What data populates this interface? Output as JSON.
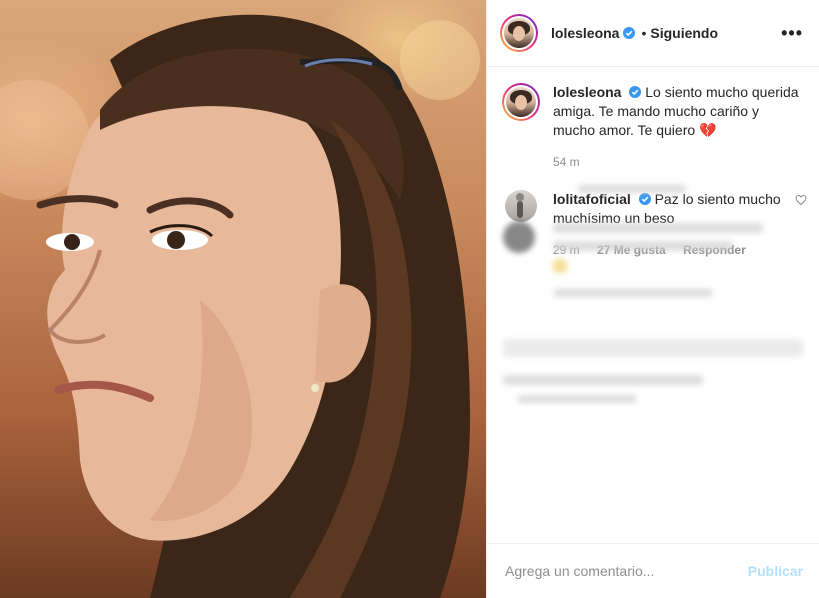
{
  "post": {
    "author": "lolesleona",
    "separator": "•",
    "follow_status": "Siguiendo",
    "more_label": "•••"
  },
  "comments": [
    {
      "user": "lolesleona",
      "text": "Lo siento mucho querida amiga. Te mando mucho cariño y mucho amor. Te quiero 💔",
      "time": "54 m"
    },
    {
      "user": "lolitafoficial",
      "text": "Paz lo siento mucho muchísimo un beso",
      "time": "29 m",
      "likes": "27 Me gusta",
      "reply": "Responder"
    }
  ],
  "add_comment": {
    "placeholder": "Agrega un comentario...",
    "publish": "Publicar"
  },
  "colors": {
    "verified": "#3897f0",
    "publish": "#b2dffc",
    "divider": "#efefef"
  }
}
